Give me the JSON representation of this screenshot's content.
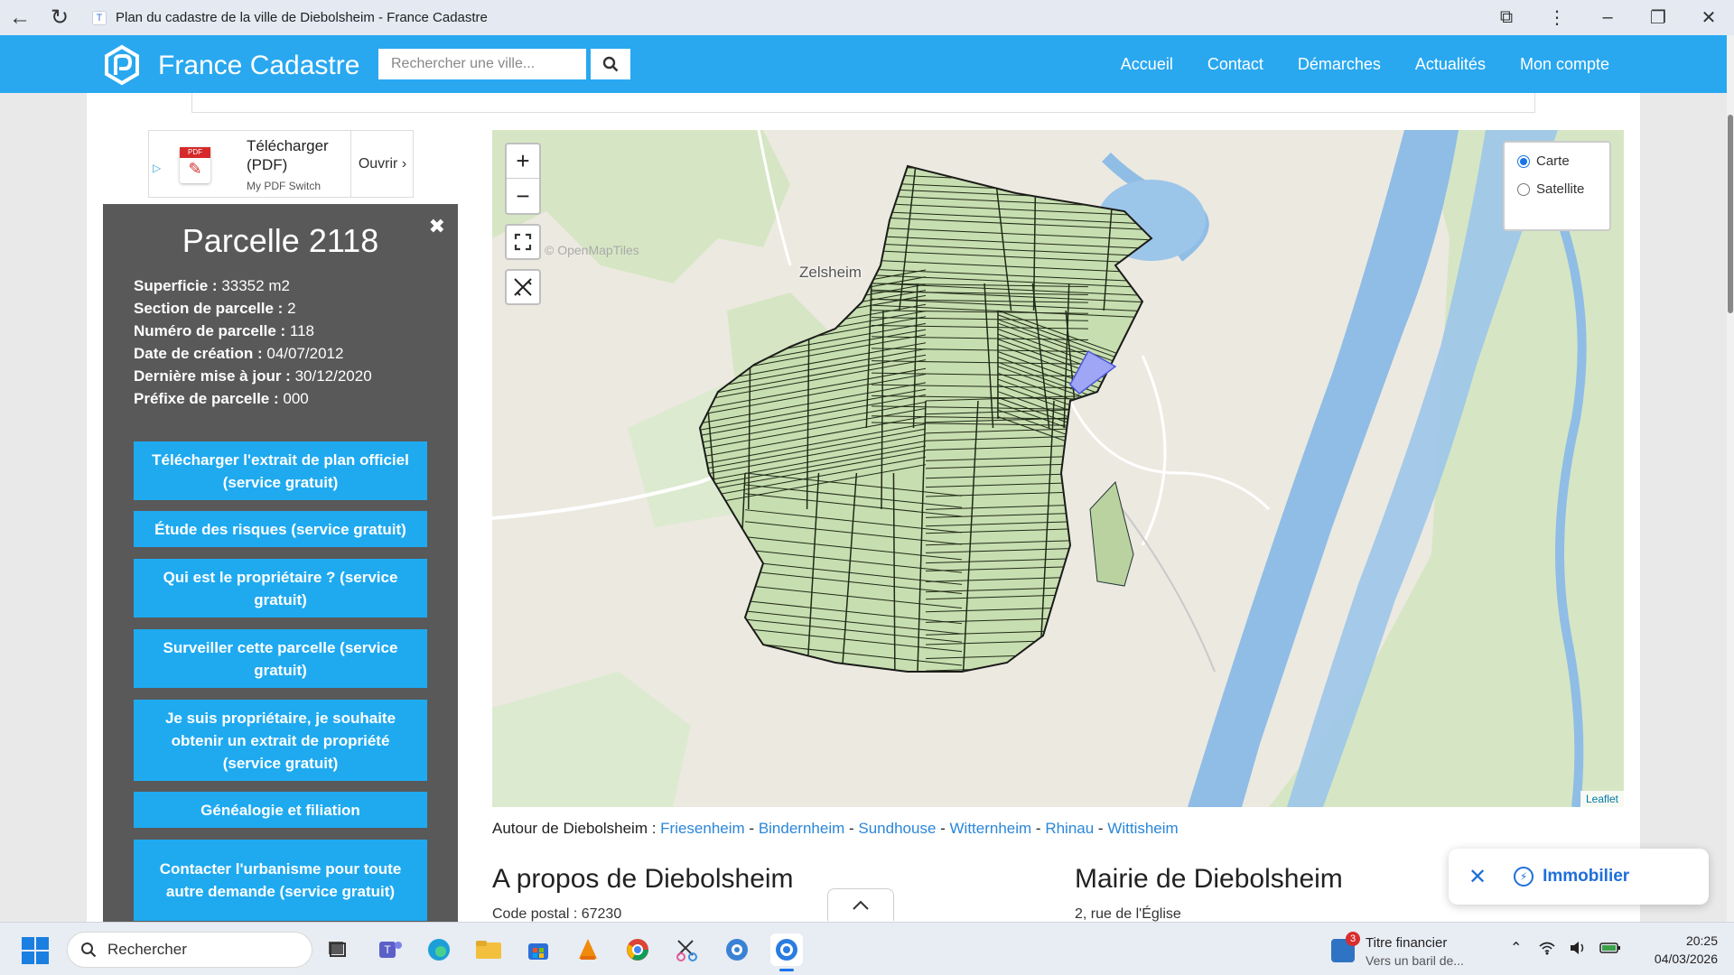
{
  "browser": {
    "tab_title": "Plan du cadastre de la ville de Diebolsheim - France Cadastre",
    "favicon_letter": "T"
  },
  "header": {
    "brand": "France Cadastre",
    "search_placeholder": "Rechercher une ville...",
    "nav": [
      "Accueil",
      "Contact",
      "Démarches",
      "Actualités",
      "Mon compte"
    ],
    "color": "#29a8f0"
  },
  "ad": {
    "title": "Télécharger (PDF)",
    "brand": "My PDF Switch",
    "open": "Ouvrir ›",
    "pdf_tag": "PDF"
  },
  "parcel": {
    "title": "Parcelle 2118",
    "info": [
      {
        "label": "Superficie :",
        "value": " 33352 m2"
      },
      {
        "label": "Section de parcelle :",
        "value": " 2"
      },
      {
        "label": "Numéro de parcelle :",
        "value": " 118"
      },
      {
        "label": "Date de création :",
        "value": " 04/07/2012"
      },
      {
        "label": "Dernière mise à jour :",
        "value": " 30/12/2020"
      },
      {
        "label": "Préfixe de parcelle :",
        "value": " 000"
      }
    ],
    "buttons": [
      "Télécharger l'extrait de plan officiel (service gratuit)",
      "Étude des risques (service gratuit)",
      "Qui est le propriétaire ? (service gratuit)",
      "Surveiller cette parcelle (service gratuit)",
      "Je suis propriétaire, je souhaite obtenir un extrait de propriété (service gratuit)",
      "Généalogie et filiation",
      "Contacter l'urbanisme pour toute autre demande (service gratuit)"
    ]
  },
  "map": {
    "zoom_in": "+",
    "zoom_out": "−",
    "layers": [
      "Carte",
      "Satellite"
    ],
    "selected_layer": "Carte",
    "place_label": "Zelsheim",
    "tiles_credit": "© OpenMapTiles",
    "attribution": "Leaflet"
  },
  "nearby": {
    "prefix": "Autour de Diebolsheim : ",
    "towns": [
      "Friesenheim",
      "Bindernheim",
      "Sundhouse",
      "Witternheim",
      "Rhinau",
      "Wittisheim"
    ]
  },
  "sections": {
    "about_title": "A propos de Diebolsheim",
    "about_sub": "Code postal : 67230",
    "mairie_title": "Mairie de Diebolsheim",
    "mairie_sub": "2, rue de l'Église"
  },
  "promo": {
    "label": "Immobilier"
  },
  "taskbar": {
    "search": "Rechercher",
    "news_title": "Titre financier",
    "news_sub": "Vers un baril de...",
    "news_badge": "3",
    "time": "20:25",
    "date": "04/03/2026"
  }
}
